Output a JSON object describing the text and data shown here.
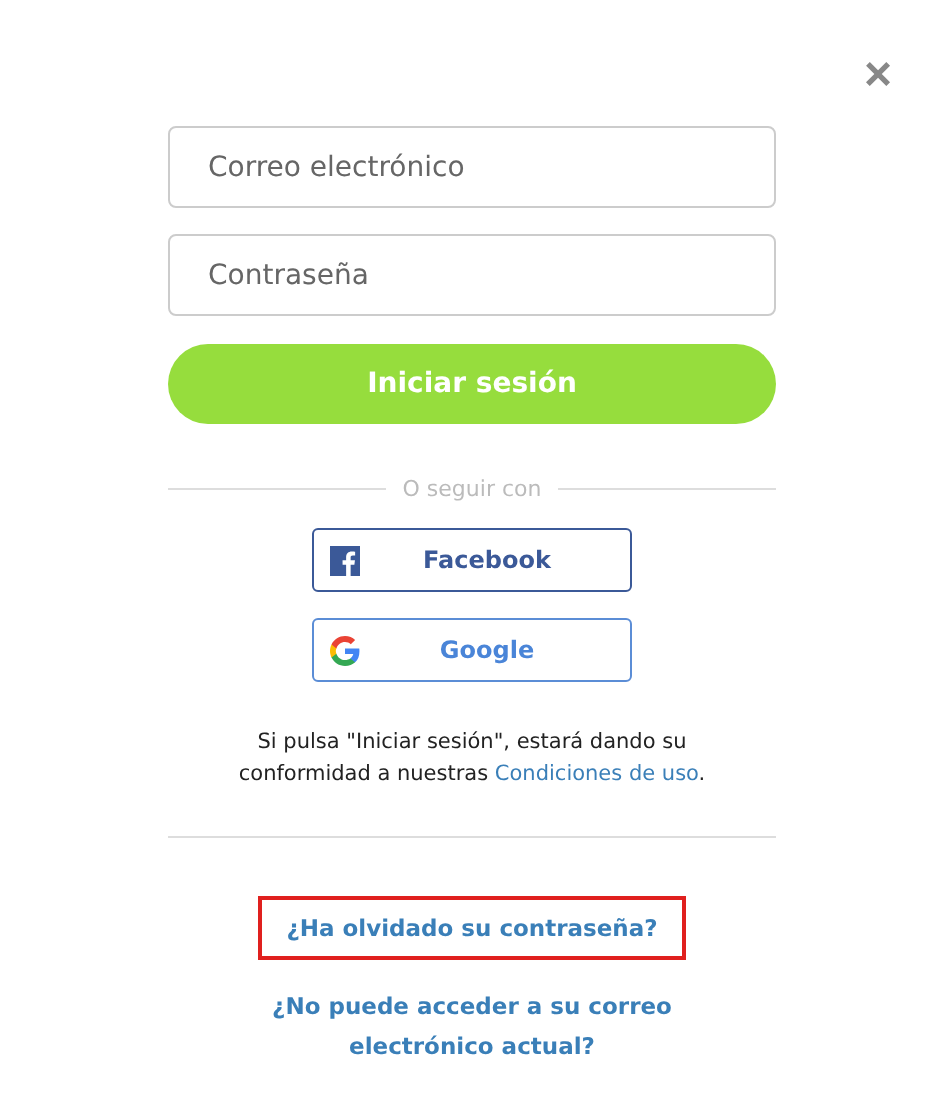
{
  "close": {
    "label": "×"
  },
  "fields": [
    {
      "placeholder": "Correo electrónico"
    },
    {
      "placeholder": "Contraseña"
    }
  ],
  "submit": {
    "label": "Iniciar sesión"
  },
  "divider": {
    "label": "O seguir con"
  },
  "social": [
    {
      "kind": "facebook",
      "label": "Facebook"
    },
    {
      "kind": "google",
      "label": "Google"
    }
  ],
  "terms": {
    "before": "Si pulsa \"Iniciar sesión\", estará dando su conformidad a nuestras ",
    "link": "Condiciones de uso",
    "after": "."
  },
  "links": [
    {
      "label": "¿Ha olvidado su contraseña?",
      "highlighted": true
    },
    {
      "label": "¿No puede acceder a su correo electrónico actual?",
      "highlighted": false
    }
  ]
}
